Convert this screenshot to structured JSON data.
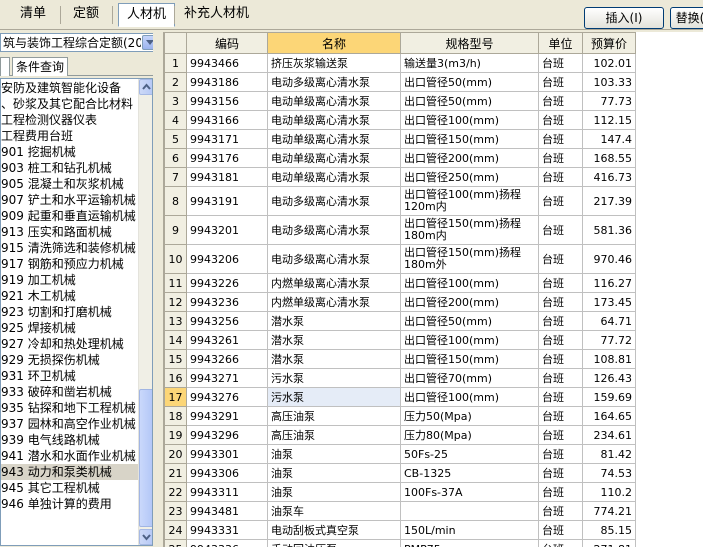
{
  "tabs": [
    "清单",
    "定额",
    "人材机",
    "补充人材机"
  ],
  "active_tab": 2,
  "buttons": {
    "insert": "插入(I)",
    "replace": "替换("
  },
  "left": {
    "combo_value": "筑与装饰工程综合定额(201",
    "subtabs": [
      "",
      "条件查询"
    ],
    "tree": [
      "安防及建筑智能化设备",
      "、砂浆及其它配合比材料",
      "工程检测仪器仪表",
      "工程费用台班",
      "901 挖掘机械",
      "903 桩工和钻孔机械",
      "905 混凝土和灰浆机械",
      "907 铲土和水平运输机械",
      "909 起重和垂直运输机械",
      "913 压实和路面机械",
      "915 清洗筛选和装修机械",
      "917 钢筋和预应力机械",
      "919 加工机械",
      "921 木工机械",
      "923 切割和打磨机械",
      "925 焊接机械",
      "927 冷却和热处理机械",
      "929 无损探伤机械",
      "931 环卫机械",
      "933 破碎和凿岩机械",
      "935 钻探和地下工程机械",
      "937 园林和高空作业机械",
      "939 电气线路机械",
      "941 潜水和水面作业机械",
      "943 动力和泵类机械",
      "945 其它工程机械",
      "946 单独计算的费用"
    ],
    "selected_index": 24
  },
  "grid": {
    "headers": [
      "",
      "编码",
      "名称",
      "规格型号",
      "单位",
      "预算价"
    ],
    "rows": [
      [
        "1",
        "9943466",
        "挤压灰浆输送泵",
        "输送量3(m3/h)",
        "台班",
        "102.01"
      ],
      [
        "2",
        "9943186",
        "电动多级离心清水泵",
        "出口管径50(mm)",
        "台班",
        "103.33"
      ],
      [
        "3",
        "9943156",
        "电动单级离心清水泵",
        "出口管径50(mm)",
        "台班",
        "77.73"
      ],
      [
        "4",
        "9943166",
        "电动单级离心清水泵",
        "出口管径100(mm)",
        "台班",
        "112.15"
      ],
      [
        "5",
        "9943171",
        "电动单级离心清水泵",
        "出口管径150(mm)",
        "台班",
        "147.4"
      ],
      [
        "6",
        "9943176",
        "电动单级离心清水泵",
        "出口管径200(mm)",
        "台班",
        "168.55"
      ],
      [
        "7",
        "9943181",
        "电动单级离心清水泵",
        "出口管径250(mm)",
        "台班",
        "416.73"
      ],
      [
        "8",
        "9943191",
        "电动多级离心清水泵",
        "出口管径100(mm)扬程120m内",
        "台班",
        "217.39"
      ],
      [
        "9",
        "9943201",
        "电动多级离心清水泵",
        "出口管径150(mm)扬程180m内",
        "台班",
        "581.36"
      ],
      [
        "10",
        "9943206",
        "电动多级离心清水泵",
        "出口管径150(mm)扬程180m外",
        "台班",
        "970.46"
      ],
      [
        "11",
        "9943226",
        "内燃单级离心清水泵",
        "出口管径100(mm)",
        "台班",
        "116.27"
      ],
      [
        "12",
        "9943236",
        "内燃单级离心清水泵",
        "出口管径200(mm)",
        "台班",
        "173.45"
      ],
      [
        "13",
        "9943256",
        "潜水泵",
        "出口管径50(mm)",
        "台班",
        "64.71"
      ],
      [
        "14",
        "9943261",
        "潜水泵",
        "出口管径100(mm)",
        "台班",
        "77.72"
      ],
      [
        "15",
        "9943266",
        "潜水泵",
        "出口管径150(mm)",
        "台班",
        "108.81"
      ],
      [
        "16",
        "9943271",
        "污水泵",
        "出口管径70(mm)",
        "台班",
        "126.43"
      ],
      [
        "17",
        "9943276",
        "污水泵",
        "出口管径100(mm)",
        "台班",
        "159.69"
      ],
      [
        "18",
        "9943291",
        "高压油泵",
        "压力50(Mpa)",
        "台班",
        "164.65"
      ],
      [
        "19",
        "9943296",
        "高压油泵",
        "压力80(Mpa)",
        "台班",
        "234.61"
      ],
      [
        "20",
        "9943301",
        "油泵",
        "50Fs-25",
        "台班",
        "81.42"
      ],
      [
        "21",
        "9943306",
        "油泵",
        "CB-1325",
        "台班",
        "74.53"
      ],
      [
        "22",
        "9943311",
        "油泵",
        "100Fs-37A",
        "台班",
        "110.2"
      ],
      [
        "23",
        "9943481",
        "油泵车",
        "",
        "台班",
        "774.21"
      ],
      [
        "24",
        "9943331",
        "电动刮板式真空泵",
        "150L/min",
        "台班",
        "85.15"
      ],
      [
        "25",
        "9943336",
        "手动回油压泵",
        "PMP75",
        "台班",
        "271.81"
      ]
    ],
    "selected_row": 16
  }
}
